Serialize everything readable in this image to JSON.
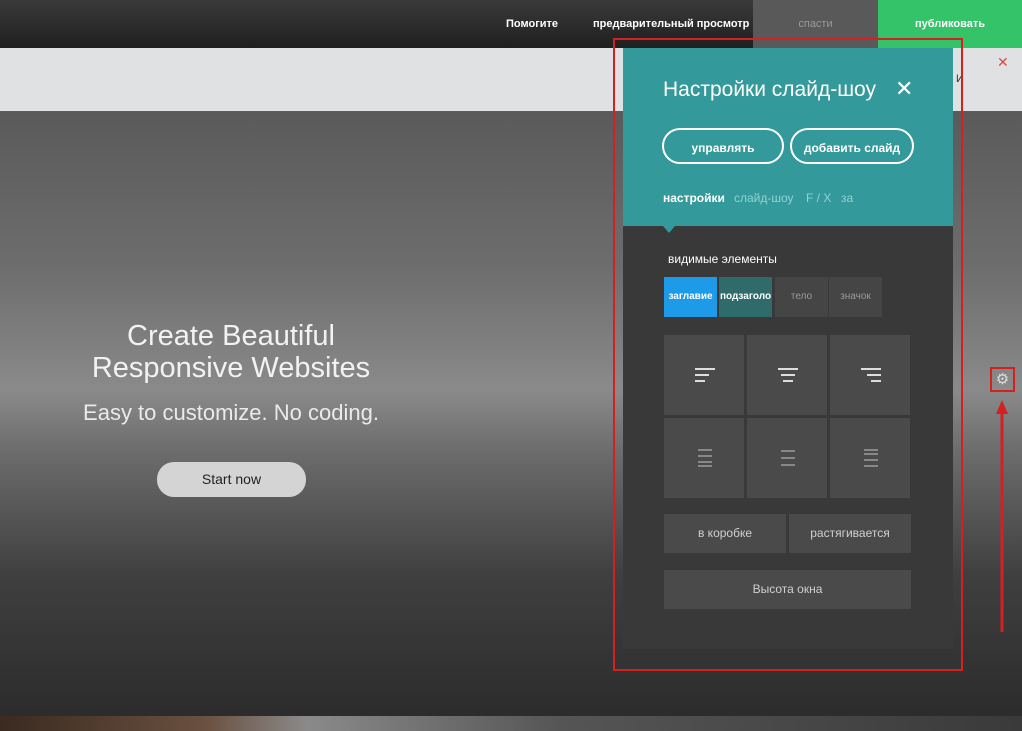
{
  "topbar": {
    "help_label": "Помогите",
    "preview_label": "предварительный просмотр",
    "save_label": "спасти",
    "publish_label": "публиковать"
  },
  "subbar": {
    "close_symbol": "✕",
    "truncated_text": "И"
  },
  "hero": {
    "title_line1": "Create Beautiful",
    "title_line2": "Responsive Websites",
    "subtitle": "Easy to customize. No coding.",
    "cta_label": "Start now"
  },
  "panel": {
    "title": "Настройки слайд-шоу",
    "close_symbol": "✕",
    "manage_label": "управлять",
    "add_slide_label": "добавить слайд",
    "tabs": [
      {
        "label": "настройки",
        "active": true
      },
      {
        "label": "слайд-шоу",
        "active": false
      },
      {
        "label": "F / X",
        "active": false
      },
      {
        "label": "за",
        "active": false
      }
    ],
    "visible_elements_label": "видимые элементы",
    "chips": [
      {
        "label": "заглавие",
        "state": "on",
        "color": "#1e9be8"
      },
      {
        "label": "подзаголо",
        "state": "on",
        "color": "#2f6b6b"
      },
      {
        "label": "тело",
        "state": "off",
        "color": "#454545"
      },
      {
        "label": "значок",
        "state": "off",
        "color": "#454545"
      }
    ],
    "boxed_label": "в коробке",
    "stretch_label": "растягивается",
    "window_height_label": "Высота окна"
  },
  "colors": {
    "accent_teal": "#34999a",
    "publish_green": "#35c36a",
    "highlight_red": "#d32020"
  },
  "icons": {
    "gear": "⚙"
  }
}
